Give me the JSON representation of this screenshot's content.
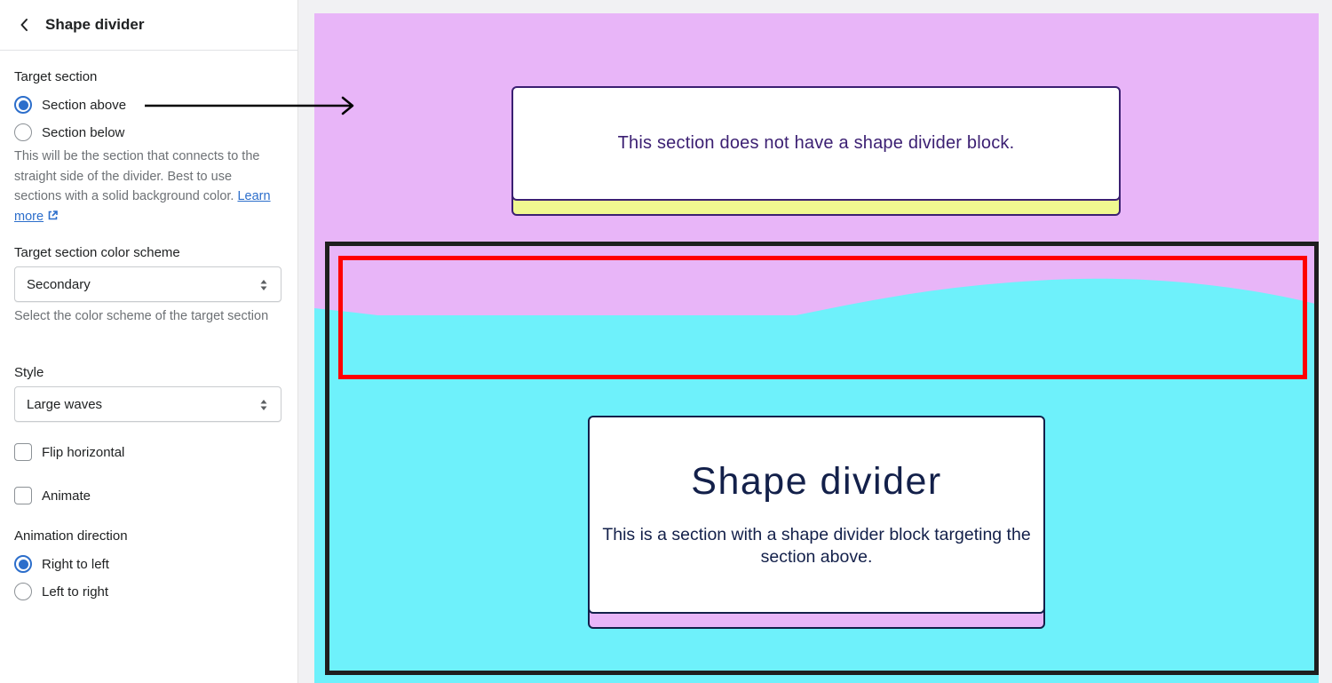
{
  "sidebar": {
    "title": "Shape divider",
    "back_icon": "chevron-left-icon",
    "target_section": {
      "label": "Target section",
      "options": [
        {
          "label": "Section above",
          "checked": true
        },
        {
          "label": "Section below",
          "checked": false
        }
      ],
      "help_text": "This will be the section that connects to the straight side of the divider. Best to use sections with a solid background color.",
      "learn_more_label": "Learn more",
      "learn_more_icon": "external-link-icon"
    },
    "color_scheme": {
      "label": "Target section color scheme",
      "value": "Secondary",
      "help_text": "Select the color scheme of the target section"
    },
    "style": {
      "label": "Style",
      "value": "Large waves"
    },
    "flip_horizontal": {
      "label": "Flip horizontal",
      "checked": false
    },
    "animate": {
      "label": "Animate",
      "checked": false
    },
    "animation_direction": {
      "label": "Animation direction",
      "options": [
        {
          "label": "Right to left",
          "checked": true
        },
        {
          "label": "Left to right",
          "checked": false
        }
      ]
    }
  },
  "preview": {
    "top_section": {
      "text": "This section does not have a shape divider block.",
      "background": "#e8b5f8",
      "card_accent": "#f0f890",
      "text_color": "#3b1f72"
    },
    "bottom_section": {
      "title": "Shape divider",
      "text": "This is a section with a shape divider block targeting the section above.",
      "background": "#6ef1fb",
      "card_accent": "#e8b5f8",
      "text_color": "#13204a"
    }
  },
  "annotations": {
    "arrow_icon": "arrow-right-icon",
    "highlight_colors": {
      "section_frame": "#1e1e1e",
      "divider_frame": "#ff0000"
    }
  },
  "colors": {
    "accent": "#2c6ecb"
  }
}
